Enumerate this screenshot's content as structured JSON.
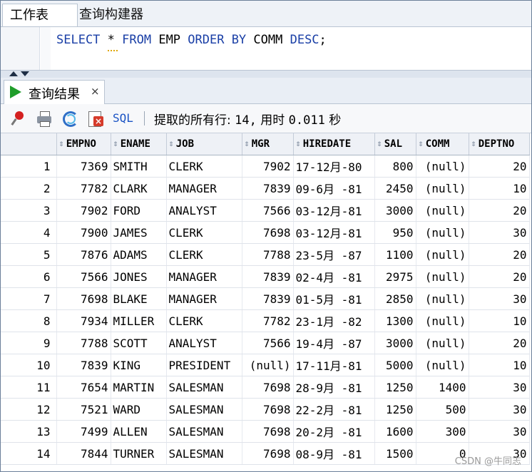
{
  "top_tabs": {
    "worksheet": "工作表",
    "query_builder": "查询构建器"
  },
  "editor": {
    "sql": [
      "SELECT",
      " * ",
      "FROM",
      " EMP ",
      "ORDER BY",
      " COMM ",
      "DESC",
      ";"
    ]
  },
  "result_tab": {
    "label": "查询结果",
    "close": "×"
  },
  "toolbar": {
    "sql_label": "SQL",
    "status_prefix": "提取的所有行:",
    "rows": "14,",
    "time_label": "用时",
    "time_value": "0.011",
    "time_unit": "秒"
  },
  "grid": {
    "columns": [
      "EMPNO",
      "ENAME",
      "JOB",
      "MGR",
      "HIREDATE",
      "SAL",
      "COMM",
      "DEPTNO"
    ],
    "rows": [
      [
        "1",
        "7369",
        "SMITH",
        "CLERK",
        "7902",
        "17-12月-80",
        "800",
        "(null)",
        "20"
      ],
      [
        "2",
        "7782",
        "CLARK",
        "MANAGER",
        "7839",
        "09-6月 -81",
        "2450",
        "(null)",
        "10"
      ],
      [
        "3",
        "7902",
        "FORD",
        "ANALYST",
        "7566",
        "03-12月-81",
        "3000",
        "(null)",
        "20"
      ],
      [
        "4",
        "7900",
        "JAMES",
        "CLERK",
        "7698",
        "03-12月-81",
        "950",
        "(null)",
        "30"
      ],
      [
        "5",
        "7876",
        "ADAMS",
        "CLERK",
        "7788",
        "23-5月 -87",
        "1100",
        "(null)",
        "20"
      ],
      [
        "6",
        "7566",
        "JONES",
        "MANAGER",
        "7839",
        "02-4月 -81",
        "2975",
        "(null)",
        "20"
      ],
      [
        "7",
        "7698",
        "BLAKE",
        "MANAGER",
        "7839",
        "01-5月 -81",
        "2850",
        "(null)",
        "30"
      ],
      [
        "8",
        "7934",
        "MILLER",
        "CLERK",
        "7782",
        "23-1月 -82",
        "1300",
        "(null)",
        "10"
      ],
      [
        "9",
        "7788",
        "SCOTT",
        "ANALYST",
        "7566",
        "19-4月 -87",
        "3000",
        "(null)",
        "20"
      ],
      [
        "10",
        "7839",
        "KING",
        "PRESIDENT",
        "(null)",
        "17-11月-81",
        "5000",
        "(null)",
        "10"
      ],
      [
        "11",
        "7654",
        "MARTIN",
        "SALESMAN",
        "7698",
        "28-9月 -81",
        "1250",
        "1400",
        "30"
      ],
      [
        "12",
        "7521",
        "WARD",
        "SALESMAN",
        "7698",
        "22-2月 -81",
        "1250",
        "500",
        "30"
      ],
      [
        "13",
        "7499",
        "ALLEN",
        "SALESMAN",
        "7698",
        "20-2月 -81",
        "1600",
        "300",
        "30"
      ],
      [
        "14",
        "7844",
        "TURNER",
        "SALESMAN",
        "7698",
        "08-9月 -81",
        "1500",
        "0",
        "30"
      ]
    ]
  },
  "watermark": "CSDN @牛同志"
}
